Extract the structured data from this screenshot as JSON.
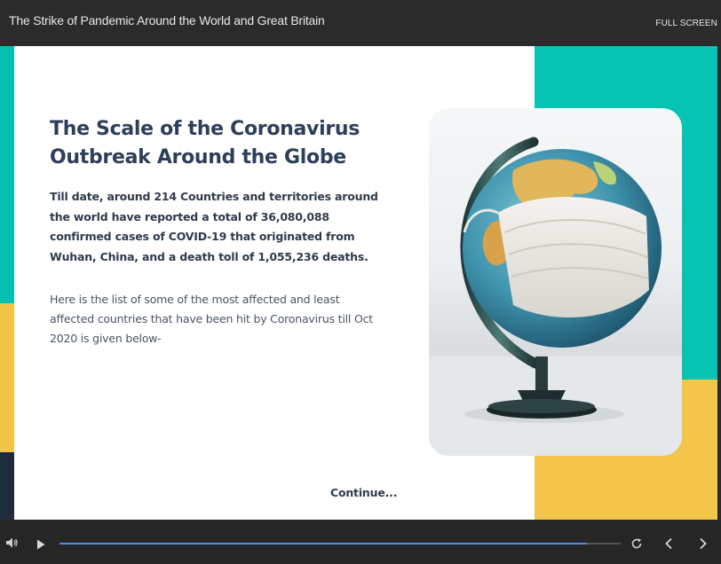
{
  "header": {
    "title": "The Strike of Pandemic Around the World and Great Britain",
    "fullscreen_label": "FULL SCREEN"
  },
  "slide": {
    "heading": "The Scale of the Coronavirus Outbreak Around the Globe",
    "paragraph_bold": "Till date, around 214 Countries and territories around the world have reported a total of 36,080,088 confirmed cases of COVID-19 that originated from Wuhan, China, and a death toll of 1,055,236 deaths.",
    "paragraph": "Here is the list of some of the most affected and least affected countries that have been hit by Coronavirus till Oct 2020 is given below-",
    "continue_label": "Continue..."
  },
  "player": {
    "progress_fraction": 0.94,
    "icons": [
      "volume-icon",
      "play-icon",
      "replay-icon",
      "previous-icon",
      "next-icon"
    ]
  },
  "colors": {
    "accent_teal": "#06c3b4",
    "accent_yellow": "#f3c54b",
    "heading_navy": "#2d3f5a",
    "progress_blue": "#4a90e2"
  }
}
